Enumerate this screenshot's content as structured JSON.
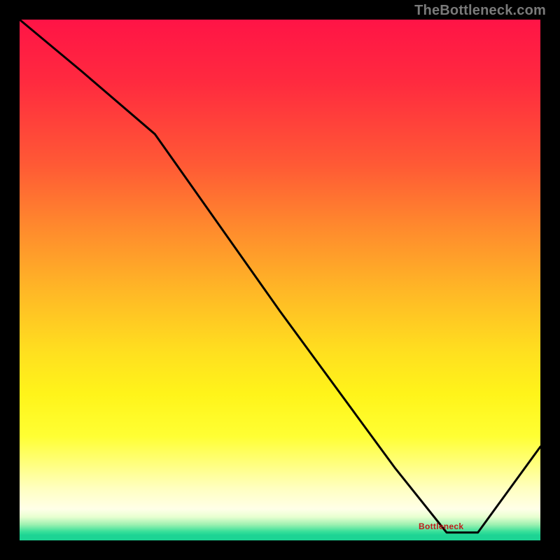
{
  "watermark": "TheBottleneck.com",
  "bottleneck_label": "Bottleneck",
  "colors": {
    "frame_bg": "#000000",
    "curve": "#000000",
    "label": "#c11a1a",
    "watermark": "#7a7a7a"
  },
  "chart_data": {
    "type": "line",
    "title": "",
    "xlabel": "",
    "ylabel": "",
    "xlim": [
      0,
      100
    ],
    "ylim": [
      0,
      100
    ],
    "annotations": [
      {
        "text": "Bottleneck",
        "x": 82,
        "y": 1.8
      }
    ],
    "series": [
      {
        "name": "bottleneck-curve",
        "x": [
          0,
          12,
          26,
          50,
          72,
          82,
          88,
          100
        ],
        "y": [
          100,
          90,
          78,
          44,
          14,
          1.5,
          1.5,
          18
        ]
      }
    ],
    "gradient_stops": [
      {
        "pct": 0,
        "color": "#ff1446"
      },
      {
        "pct": 28,
        "color": "#ff5a35"
      },
      {
        "pct": 64,
        "color": "#ffe01f"
      },
      {
        "pct": 90,
        "color": "#ffffc0"
      },
      {
        "pct": 97,
        "color": "#9bf0b0"
      },
      {
        "pct": 100,
        "color": "#1dd494"
      }
    ]
  }
}
